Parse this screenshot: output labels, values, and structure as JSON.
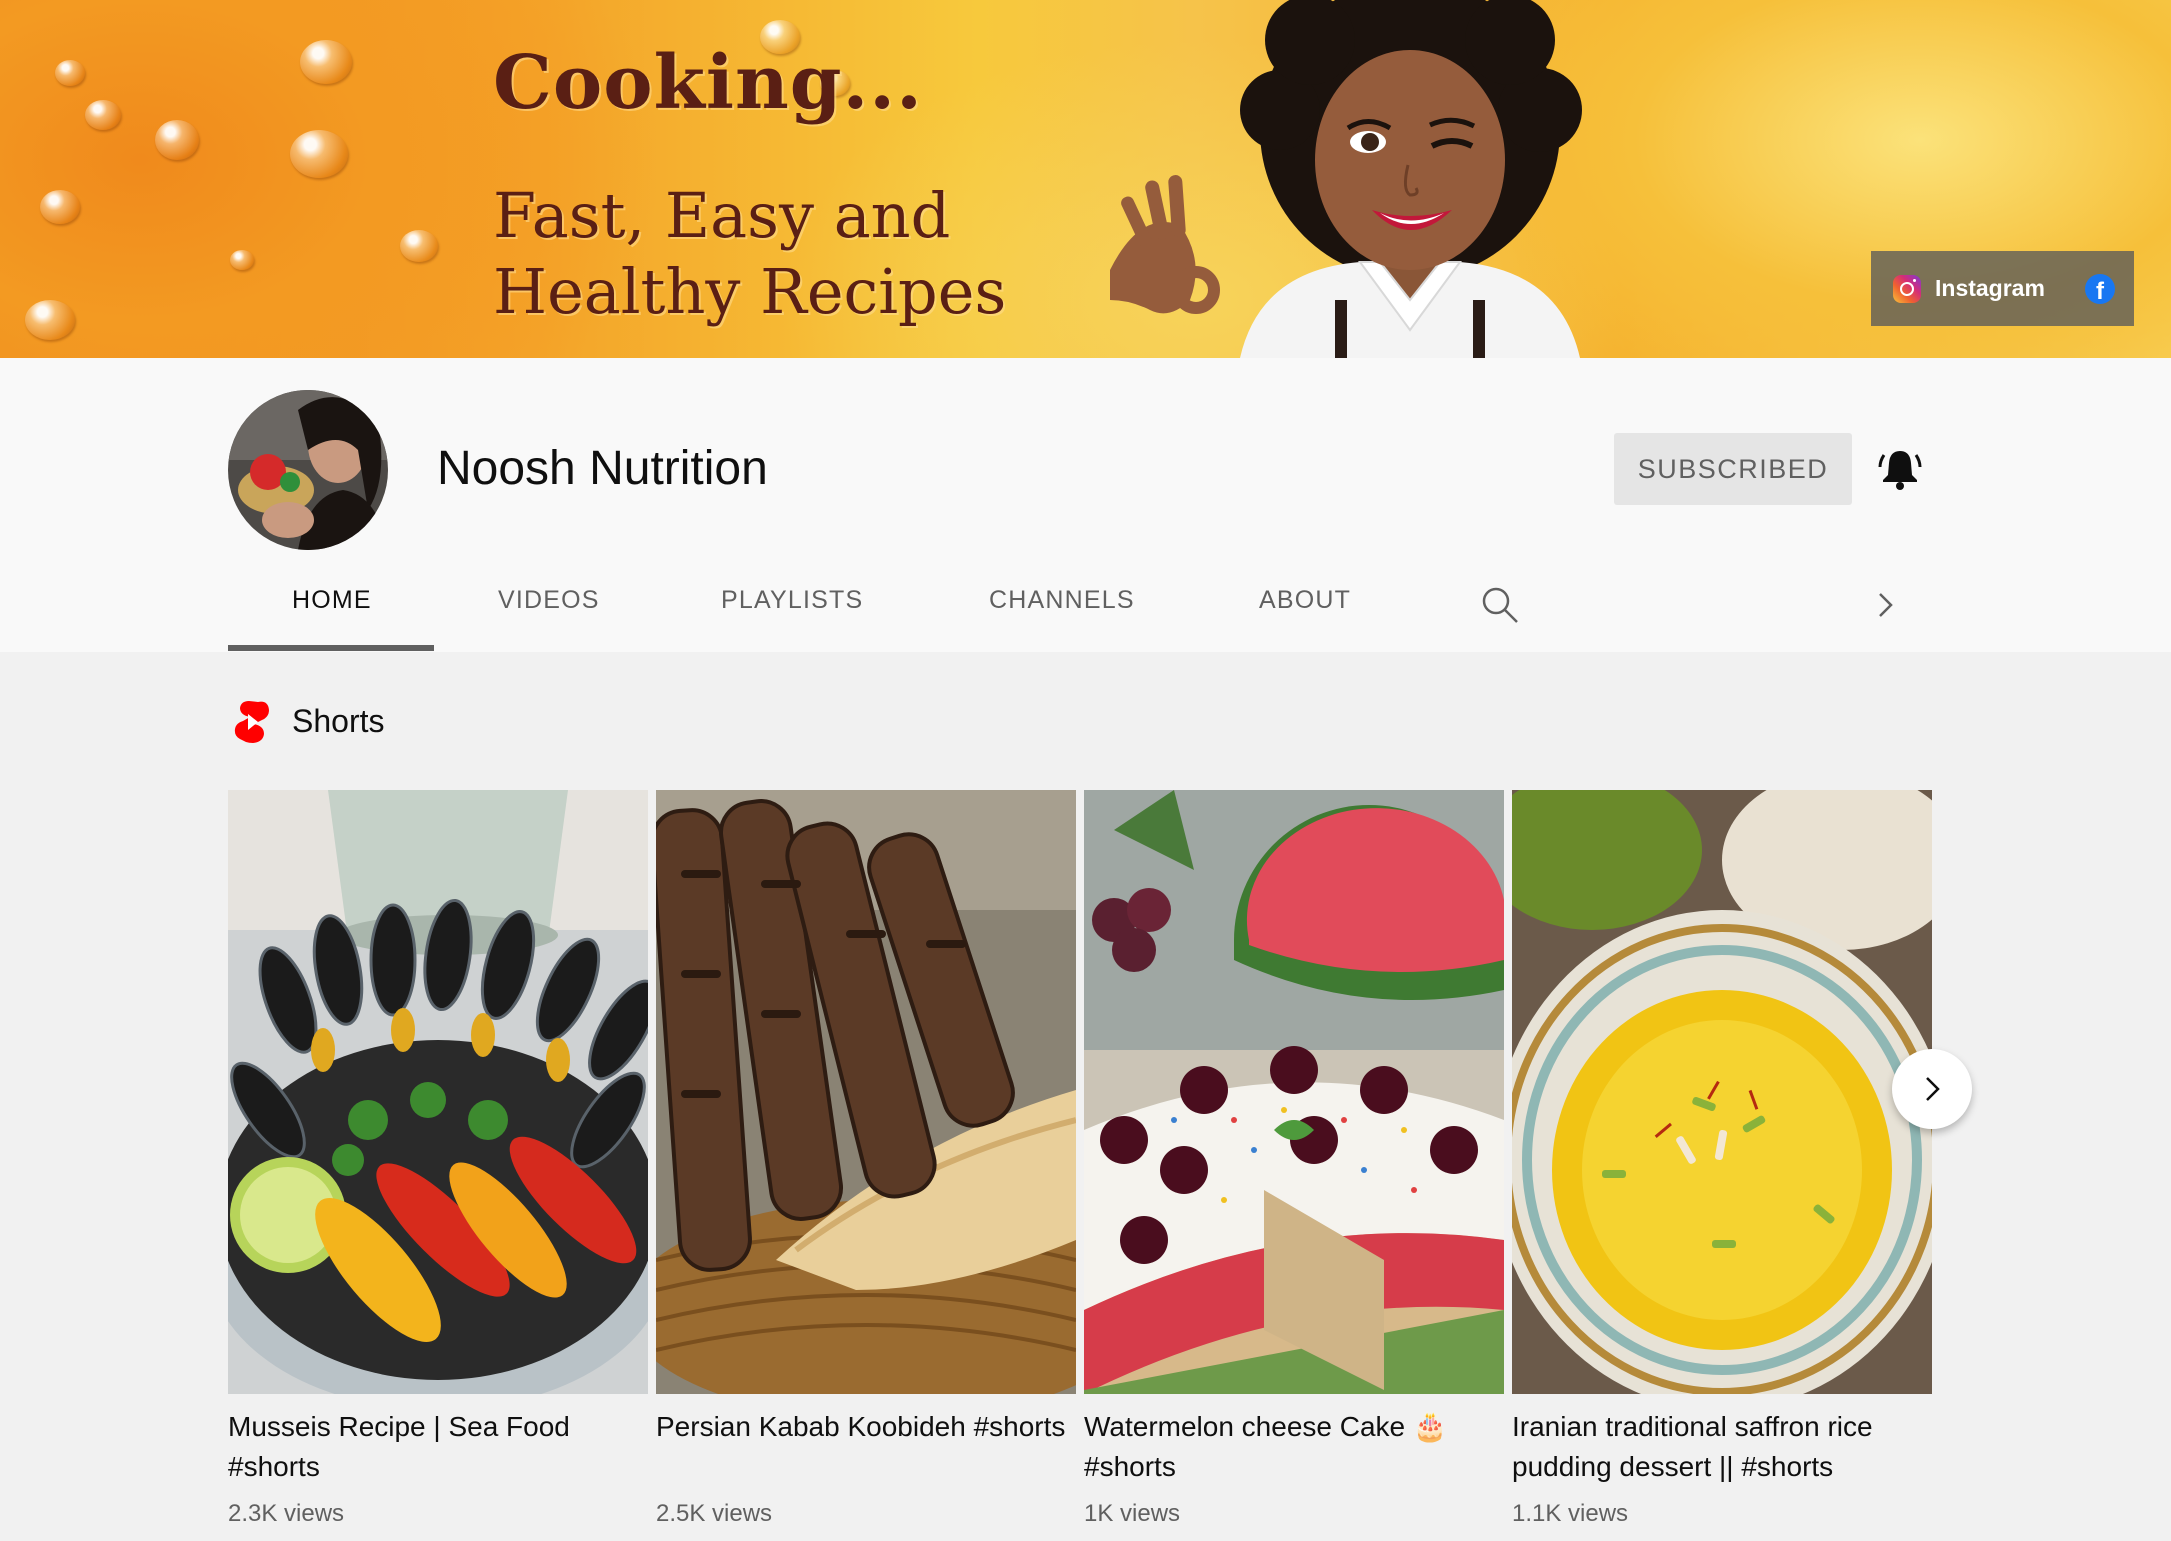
{
  "banner": {
    "title": "Cooking...",
    "subtitle_line1": "Fast, Easy and",
    "subtitle_line2": "Healthy Recipes",
    "links": [
      {
        "label": "Instagram",
        "icon": "instagram-icon"
      },
      {
        "label": "",
        "icon": "facebook-icon"
      }
    ]
  },
  "channel": {
    "name": "Noosh Nutrition",
    "subscribe_label": "SUBSCRIBED",
    "bell_icon": "bell-ringing-icon"
  },
  "tabs": [
    {
      "label": "HOME",
      "active": true
    },
    {
      "label": "VIDEOS",
      "active": false
    },
    {
      "label": "PLAYLISTS",
      "active": false
    },
    {
      "label": "CHANNELS",
      "active": false
    },
    {
      "label": "ABOUT",
      "active": false
    }
  ],
  "shelf": {
    "title": "Shorts",
    "icon": "shorts-logo-icon",
    "items": [
      {
        "title": "Musseis Recipe | Sea Food #shorts",
        "views": "2.3K views"
      },
      {
        "title": "Persian Kabab Koobideh #shorts",
        "views": "2.5K views"
      },
      {
        "title": "Watermelon cheese Cake 🎂 #shorts",
        "views": "1K views"
      },
      {
        "title": "Iranian traditional saffron rice pudding dessert || #shorts",
        "views": "1.1K views"
      }
    ]
  },
  "colors": {
    "accent_red": "#ff0000",
    "text_primary": "#0f0f0f",
    "text_secondary": "#606060",
    "page_bg": "#f1f1f1",
    "header_bg": "#f9f9f9"
  }
}
